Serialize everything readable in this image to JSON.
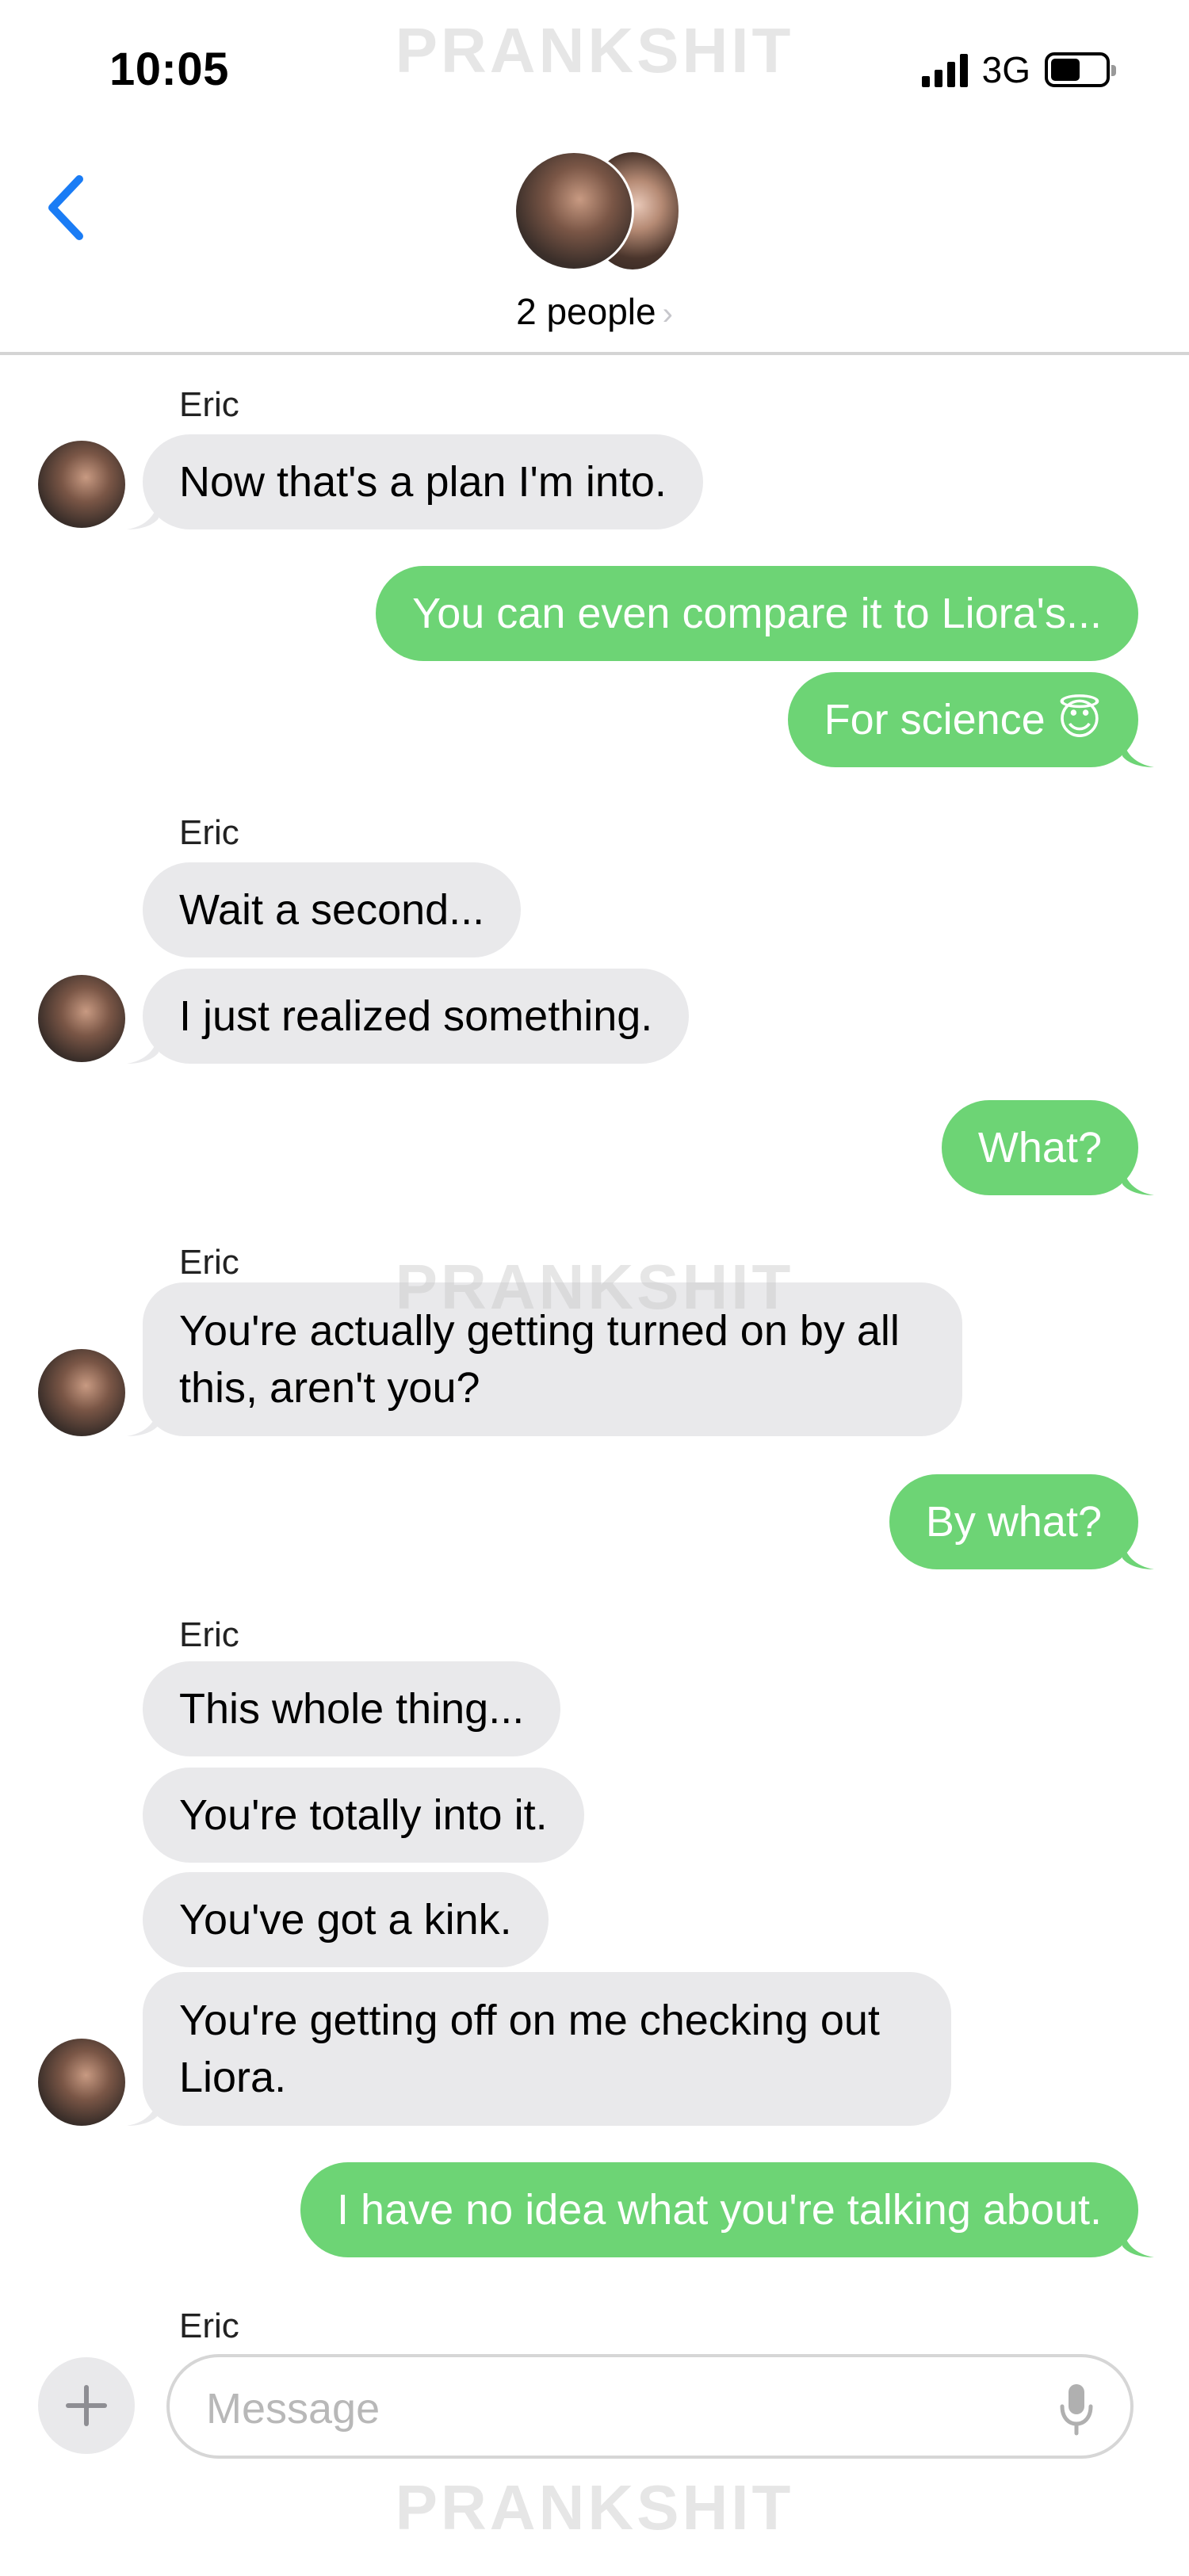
{
  "status_bar": {
    "time": "10:05",
    "network": "3G",
    "icons": [
      "signal-icon",
      "battery-icon"
    ]
  },
  "watermark": "PRANKSHIT",
  "header": {
    "people_label": "2 people",
    "chevron": "›",
    "icons": [
      "back-chevron-icon",
      "group-avatar"
    ]
  },
  "messages": [
    {
      "sender": "Eric",
      "text": "Now that's a plan I'm into."
    },
    {
      "text": "You can even compare it to Liora's..."
    },
    {
      "text": "For science 😇"
    },
    {
      "sender": "Eric",
      "text": "Wait a second..."
    },
    {
      "text": "I just realized something."
    },
    {
      "text": "What?"
    },
    {
      "sender": "Eric",
      "text": "You're actually getting turned on by all this, aren't you?"
    },
    {
      "text": "By what?"
    },
    {
      "sender": "Eric",
      "text": "This whole thing..."
    },
    {
      "text": "You're totally into it."
    },
    {
      "text": "You've got a kink."
    },
    {
      "text": "You're getting off on me checking out Liora."
    },
    {
      "text": "I have no idea what you're talking about."
    },
    {
      "sender": "Eric"
    }
  ],
  "input": {
    "placeholder": "Message",
    "icons": [
      "plus-icon",
      "microphone-icon"
    ]
  },
  "colors": {
    "outgoing_bubble": "#6dd475",
    "incoming_bubble": "#e9e9eb",
    "accent_blue": "#1a7cf5"
  }
}
